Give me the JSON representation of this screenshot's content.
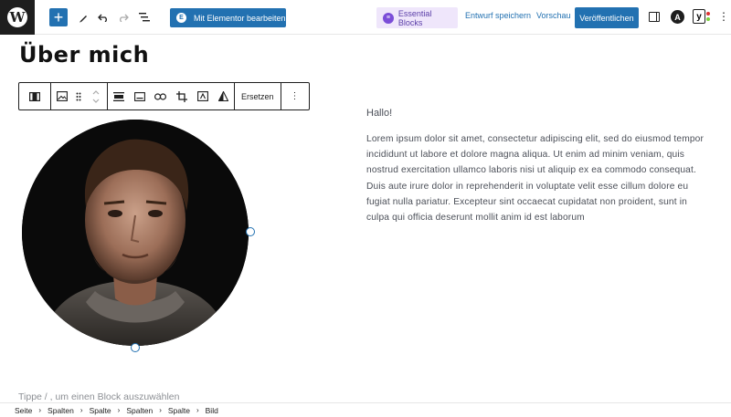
{
  "toolbar": {
    "add_label": "+",
    "elementor_label": "Mit Elementor bearbeiten",
    "essential_blocks_label": "Essential Blocks",
    "save_draft_label": "Entwurf speichern",
    "preview_label": "Vorschau",
    "publish_label": "Veröffentlichen"
  },
  "page": {
    "title": "Über mich"
  },
  "block_toolbar": {
    "replace_label": "Ersetzen"
  },
  "content": {
    "greeting": "Hallo!",
    "paragraph": "Lorem ipsum dolor sit amet, consectetur adipiscing elit, sed do eiusmod tempor incididunt ut labore et dolore magna aliqua. Ut enim ad minim veniam, quis nostrud exercitation ullamco laboris nisi ut aliquip ex ea commodo consequat. Duis aute irure dolor in reprehenderit in voluptate velit esse cillum dolore eu fugiat nulla pariatur. Excepteur sint occaecat cupidatat non proident, sunt in culpa qui officia deserunt mollit anim id est laborum"
  },
  "editor": {
    "placeholder": "Tippe / , um einen Block auszuwählen"
  },
  "breadcrumb": [
    "Seite",
    "Spalten",
    "Spalte",
    "Spalten",
    "Spalte",
    "Bild"
  ],
  "colors": {
    "accent": "#2271b1",
    "essential_blocks_bg": "#efe6fb",
    "text": "#4b4f58"
  }
}
